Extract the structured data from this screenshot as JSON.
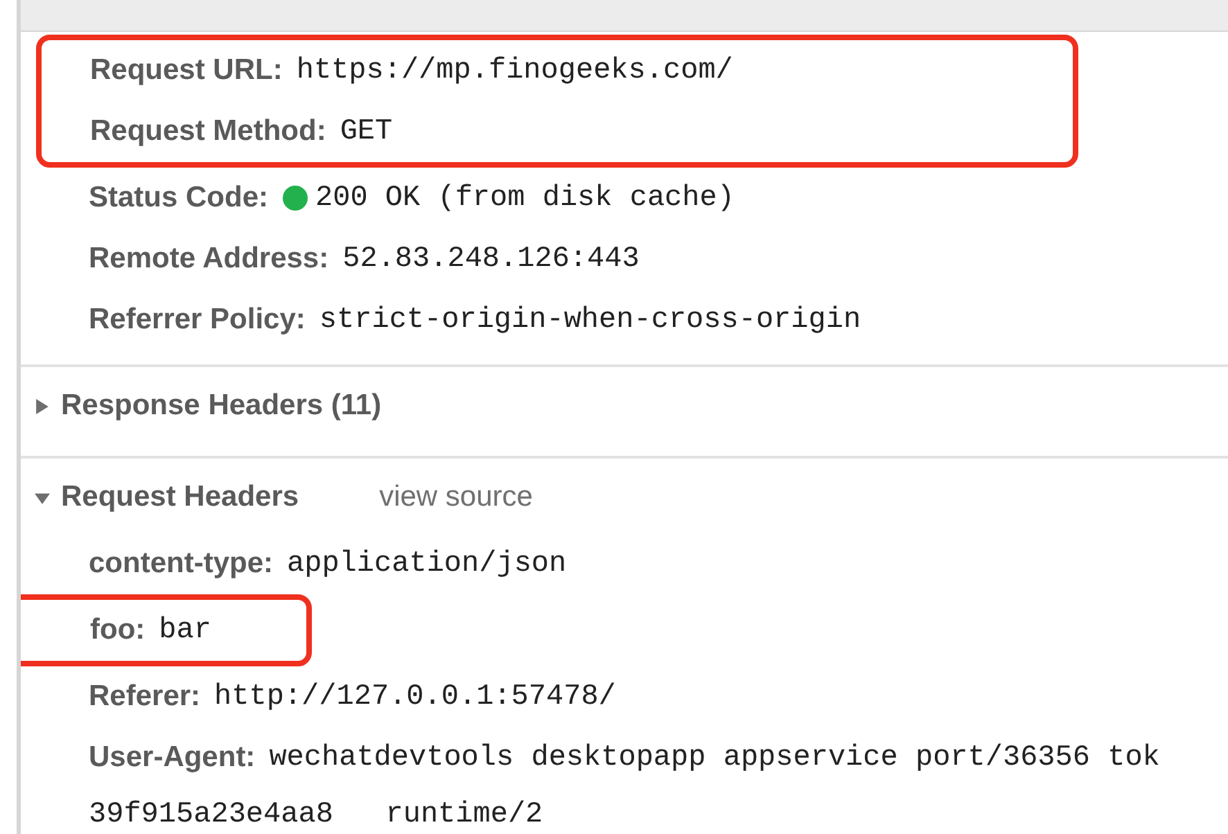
{
  "general": {
    "rows": [
      {
        "label": "Request URL:",
        "value": "https://mp.finogeeks.com/",
        "highlighted": true
      },
      {
        "label": "Request Method:",
        "value": "GET",
        "highlighted": true
      },
      {
        "label": "Status Code:",
        "value": "200 OK (from disk cache)",
        "color": "#22b14c",
        "highlighted": false
      },
      {
        "label": "Remote Address:",
        "value": "52.83.248.126:443",
        "highlighted": false
      },
      {
        "label": "Referrer Policy:",
        "value": "strict-origin-when-cross-origin",
        "highlighted": false
      }
    ]
  },
  "sections": [
    {
      "title": "Response Headers (11)",
      "expanded": false
    },
    {
      "title": "Request Headers",
      "expanded": true,
      "link": "view source",
      "rows": [
        {
          "label": "content-type:",
          "value": "application/json",
          "highlighted": false
        },
        {
          "label": "foo:",
          "value": "bar",
          "highlighted": true
        },
        {
          "label": "Referer:",
          "value": "http://127.0.0.1:57478/",
          "highlighted": false
        },
        {
          "label": "User-Agent:",
          "value": "wechatdevtools desktopapp appservice port/36356 tok",
          "continuation": "39f915a23e4aa8   runtime/2",
          "highlighted": false
        }
      ]
    }
  ]
}
